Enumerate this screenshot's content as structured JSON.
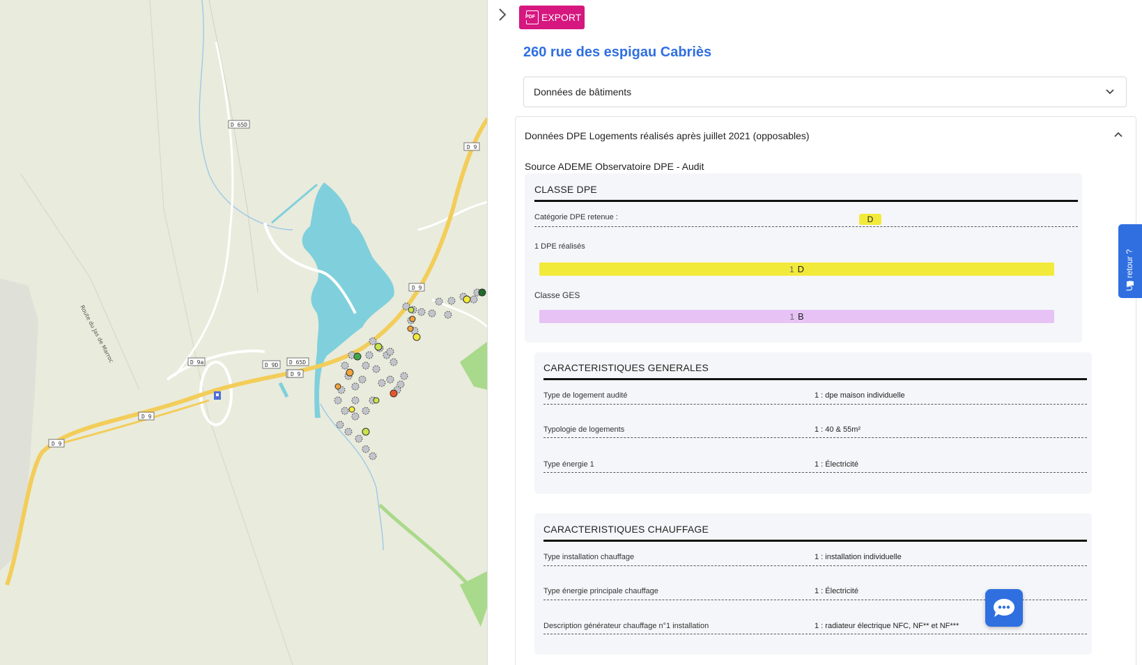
{
  "panel": {
    "export_label": "EXPORT",
    "pdf_icon_text": "PDF",
    "address": "260 rue des espigau Cabriès",
    "acc_buildings_label": "Données de bâtiments",
    "acc_dpe_label": "Données DPE Logements réalisés après juillet 2021 (opposables)",
    "source": "Source ADEME Observatoire DPE - Audit"
  },
  "classe_dpe": {
    "title": "CLASSE DPE",
    "categorie_label": "Catégorie DPE retenue :",
    "categorie_value": "D",
    "realises_label": "1 DPE réalisés",
    "dpe_bar_count": "1",
    "dpe_bar_letter": "D",
    "dpe_bar_color": "#f2ea3a",
    "ges_label": "Classe GES",
    "ges_bar_count": "1",
    "ges_bar_letter": "B",
    "ges_bar_color": "#e6c2f5"
  },
  "generales": {
    "title": "CARACTERISTIQUES GENERALES",
    "rows": [
      {
        "label": "Type de logement audité",
        "value": "1 : dpe maison individuelle"
      },
      {
        "label": "Typologie de logements",
        "value": "1 : 40 & 55m²"
      },
      {
        "label": "Type énergie 1",
        "value": "1 : Électricité"
      }
    ]
  },
  "chauffage": {
    "title": "CARACTERISTIQUES CHAUFFAGE",
    "rows": [
      {
        "label": "Type installation chauffage",
        "value": "1 : installation individuelle"
      },
      {
        "label": "Type énergie principale chauffage",
        "value": "1 : Électricité"
      },
      {
        "label": "Description générateur chauffage n°1 installation",
        "value": "1 : radiateur électrique NFC, NF** et NF***"
      }
    ]
  },
  "feedback_label": "Un retour ?",
  "map": {
    "road_labels": [
      "D 65D",
      "D 9",
      "D 9",
      "D 9",
      "D 9",
      "D 9",
      "D 9a",
      "D 9D",
      "D 65D",
      "D 9"
    ],
    "street_label": "Route du Jas de Marroc",
    "water_color": "#7fd0dc",
    "road_color": "#f3cd5a",
    "land_color": "#e9ebdc"
  }
}
